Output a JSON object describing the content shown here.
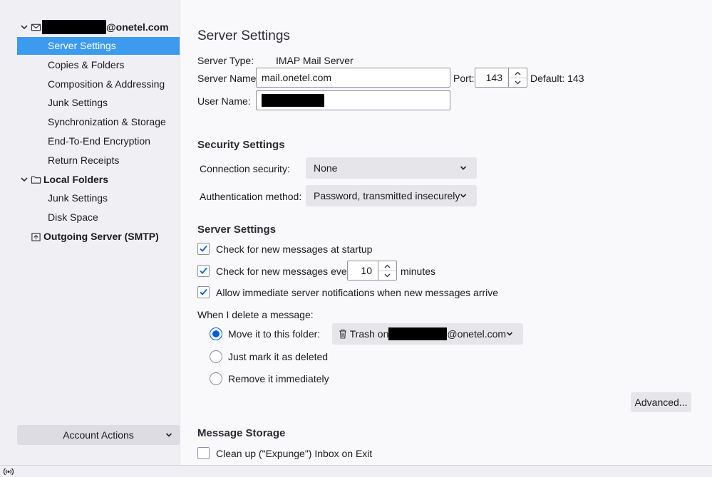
{
  "sidebar": {
    "account": {
      "email_suffix": "@onetel.com"
    },
    "account_items": [
      "Server Settings",
      "Copies & Folders",
      "Composition & Addressing",
      "Junk Settings",
      "Synchronization & Storage",
      "End-To-End Encryption",
      "Return Receipts"
    ],
    "local_folders": {
      "label": "Local Folders",
      "items": [
        "Junk Settings",
        "Disk Space"
      ]
    },
    "outgoing_server": "Outgoing Server (SMTP)",
    "account_actions": "Account Actions"
  },
  "server": {
    "title": "Server Settings",
    "type_label": "Server Type:",
    "type_value": "IMAP Mail Server",
    "name_label": "Server Name:",
    "name_value": "mail.onetel.com",
    "port_label": "Port:",
    "port_value": "143",
    "default_label": "Default: 143",
    "user_label": "User Name:"
  },
  "security": {
    "heading": "Security Settings",
    "conn_label": "Connection security:",
    "conn_value": "None",
    "auth_label": "Authentication method:",
    "auth_value": "Password, transmitted insecurely"
  },
  "server_settings": {
    "heading": "Server Settings",
    "check_startup": "Check for new messages at startup",
    "check_every": "Check for new messages every",
    "interval_value": "10",
    "minutes": "minutes",
    "allow_notifications": "Allow immediate server notifications when new messages arrive",
    "delete_label": "When I delete a message:",
    "move_option": "Move it to this folder:",
    "trash_prefix": "Trash on",
    "trash_suffix": "@onetel.com",
    "mark_option": "Just mark it as deleted",
    "remove_option": "Remove it immediately",
    "advanced_button": "Advanced..."
  },
  "storage": {
    "heading": "Message Storage",
    "cleanup": "Clean up (\"Expunge\") Inbox on Exit"
  },
  "icons": {
    "mail": "envelope-icon",
    "folder": "folder-icon",
    "smtp": "outbox-icon",
    "trash": "trash-icon",
    "status": "activity-icon"
  },
  "colors": {
    "selected": "#3d9bef",
    "accent": "#0061e0"
  }
}
